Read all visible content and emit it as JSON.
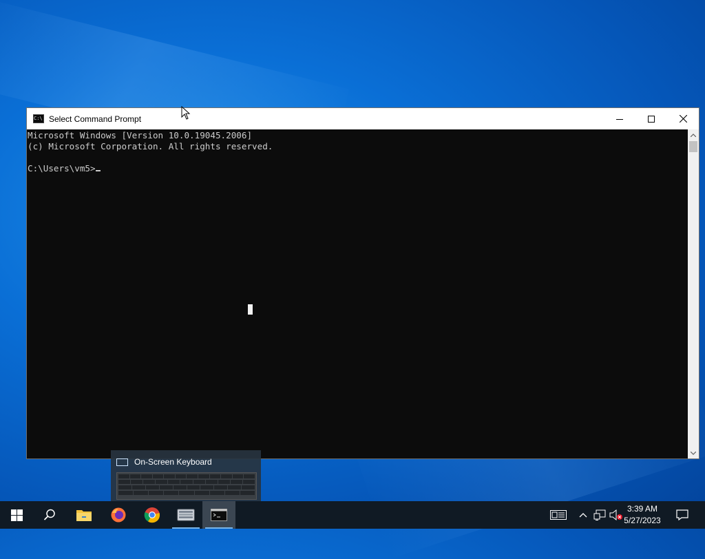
{
  "cmd_window": {
    "title": "Select Command Prompt",
    "icon_text": "C:\\.",
    "lines": [
      "Microsoft Windows [Version 10.0.19045.2006]",
      "(c) Microsoft Corporation. All rights reserved.",
      "",
      "C:\\Users\\vm5>"
    ]
  },
  "thumbnail": {
    "title": "On-Screen Keyboard"
  },
  "taskbar": {
    "items": [
      "start",
      "search",
      "file-explorer",
      "firefox",
      "chrome",
      "on-screen-keyboard",
      "command-prompt"
    ],
    "clock": {
      "time": "3:39 AM",
      "date": "5/27/2023"
    }
  },
  "colors": {
    "console_bg": "#0c0c0c",
    "console_fg": "#cccccc",
    "taskbar_bg": "#101a24",
    "desktop_blue": "#0a6fd6"
  }
}
